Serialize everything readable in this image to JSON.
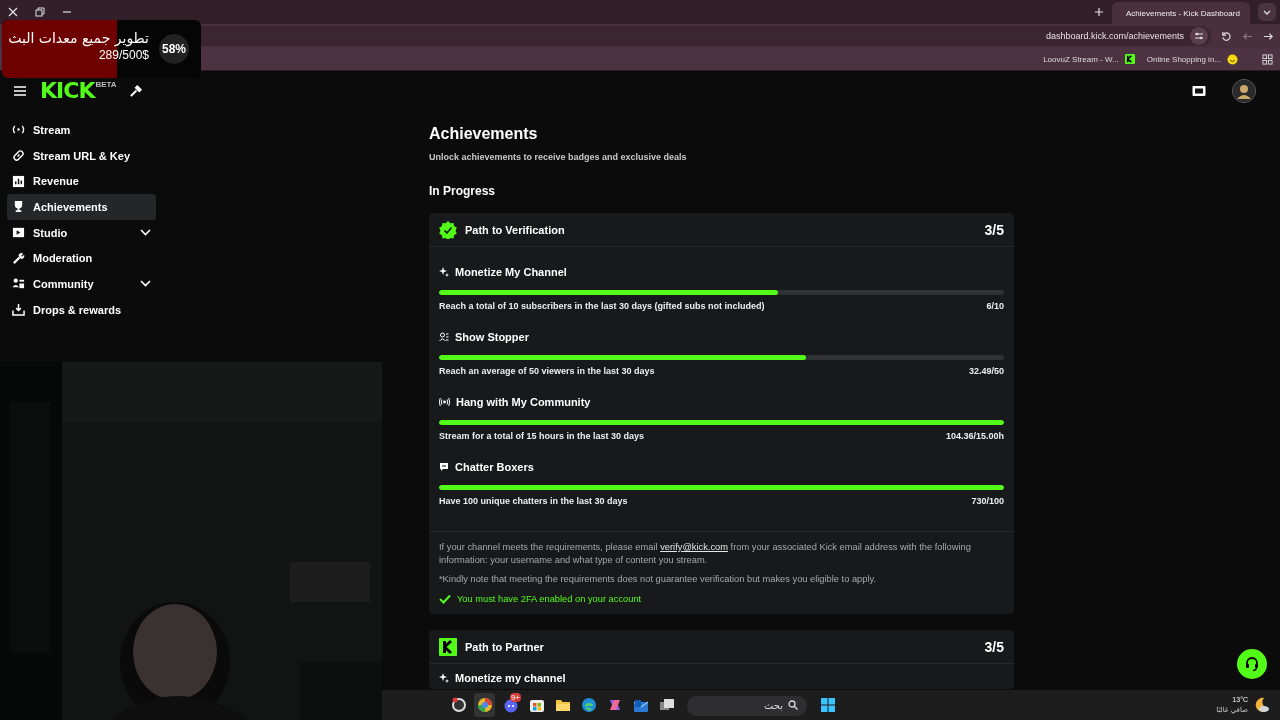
{
  "browser": {
    "tab_title": "Achievements - Kick Dashboard",
    "url": "dashboard.kick.com/achievements",
    "bookmarks": [
      {
        "label": "LoovuZ Stream - W...",
        "kind": "kick"
      },
      {
        "label": "Online Shopping in...",
        "kind": "smiley"
      }
    ]
  },
  "donation_goal": {
    "title": "تطوير جميع معدات البث",
    "amount": "289/500$",
    "percent": "58%",
    "level": 0.58
  },
  "header": {
    "logo": "KICK",
    "logo_badge": "BETA"
  },
  "sidebar": {
    "items": [
      {
        "label": "Stream",
        "selected": false,
        "expandable": false
      },
      {
        "label": "Stream URL & Key",
        "selected": false,
        "expandable": false
      },
      {
        "label": "Revenue",
        "selected": false,
        "expandable": false
      },
      {
        "label": "Achievements",
        "selected": true,
        "expandable": false
      },
      {
        "label": "Studio",
        "selected": false,
        "expandable": true
      },
      {
        "label": "Moderation",
        "selected": false,
        "expandable": false
      },
      {
        "label": "Community",
        "selected": false,
        "expandable": true
      },
      {
        "label": "Drops & rewards",
        "selected": false,
        "expandable": false
      }
    ]
  },
  "page": {
    "title": "Achievements",
    "subtitle": "Unlock achievements to receive badges and exclusive deals",
    "section": "In Progress"
  },
  "achievements": [
    {
      "kind": "verified",
      "title": "Path to Verification",
      "progress": "3/5",
      "tasks": [
        {
          "title": "Monetize My Channel",
          "description": "Reach a total of 10 subscribers in the last 30 days (gifted subs not included)",
          "value": "6/10",
          "level": 0.6
        },
        {
          "title": "Show Stopper",
          "description": "Reach an average of 50 viewers in the last 30 days",
          "value": "32.49/50",
          "level": 0.65
        },
        {
          "title": "Hang with My Community",
          "description": "Stream for a total of 15 hours in the last 30 days",
          "value": "104.36/15.00h",
          "level": 1
        },
        {
          "title": "Chatter Boxers",
          "description": "Have 100 unique chatters in the last 30 days",
          "value": "730/100",
          "level": 1
        }
      ],
      "note": {
        "before": "If your channel meets the requirements, please email ",
        "link": "verify@kick.com",
        "after": " from your associated Kick email address with the following information: your username and what type of content you stream."
      },
      "disclaimer": "*Kindly note that meeting the requirements does not guarantee verification but makes you eligible to apply.",
      "requirement": {
        "label": "You must have 2FA enabled on your account",
        "met": true
      }
    },
    {
      "kind": "kick",
      "title": "Path to Partner",
      "progress": "3/5",
      "tasks": [
        {
          "title": "Monetize my channel"
        }
      ]
    }
  ],
  "taskbar": {
    "search_placeholder": "بحث",
    "badge": "9+",
    "weather": {
      "temp": "13°C",
      "condition": "صافي غالبًا"
    }
  }
}
